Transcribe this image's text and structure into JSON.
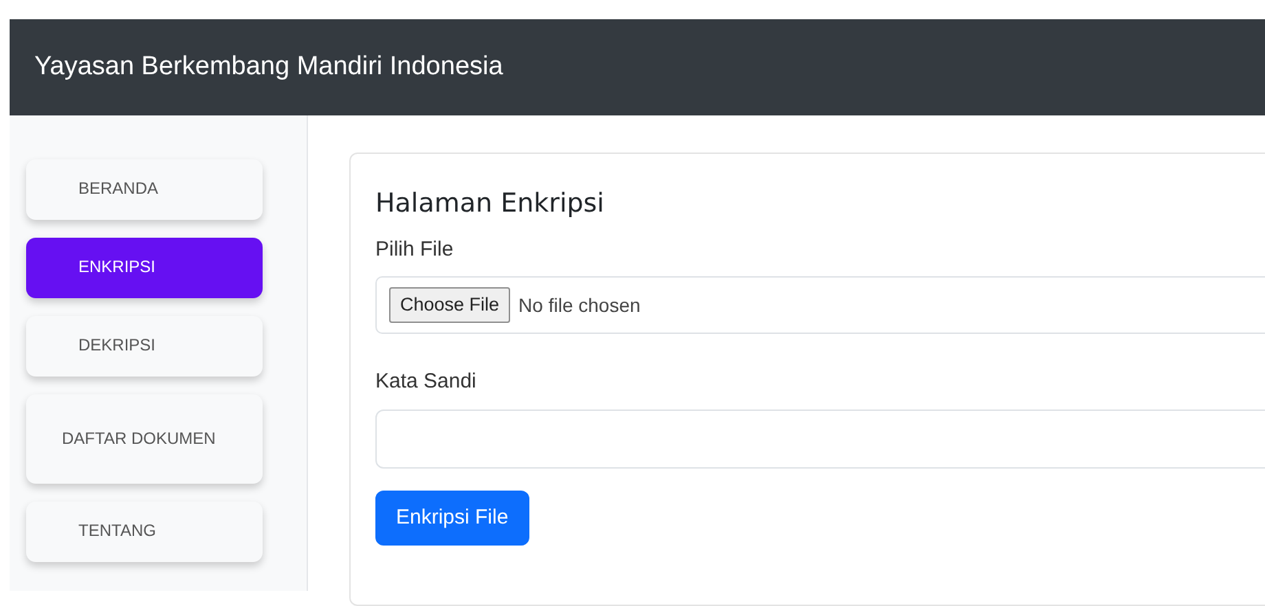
{
  "navbar": {
    "brand": "Yayasan Berkembang Mandiri Indonesia"
  },
  "sidebar": {
    "items": [
      {
        "label": "BERANDA",
        "selected": false
      },
      {
        "label": "ENKRIPSI",
        "selected": true
      },
      {
        "label": "DEKRIPSI",
        "selected": false
      },
      {
        "label": "DAFTAR DOKUMEN",
        "selected": false
      },
      {
        "label": "TENTANG",
        "selected": false
      }
    ]
  },
  "form": {
    "title": "Halaman Enkripsi",
    "file_label": "Pilih File",
    "file_button": "Choose File",
    "file_status": "No file chosen",
    "password_label": "Kata Sandi",
    "submit": "Enkripsi File"
  }
}
